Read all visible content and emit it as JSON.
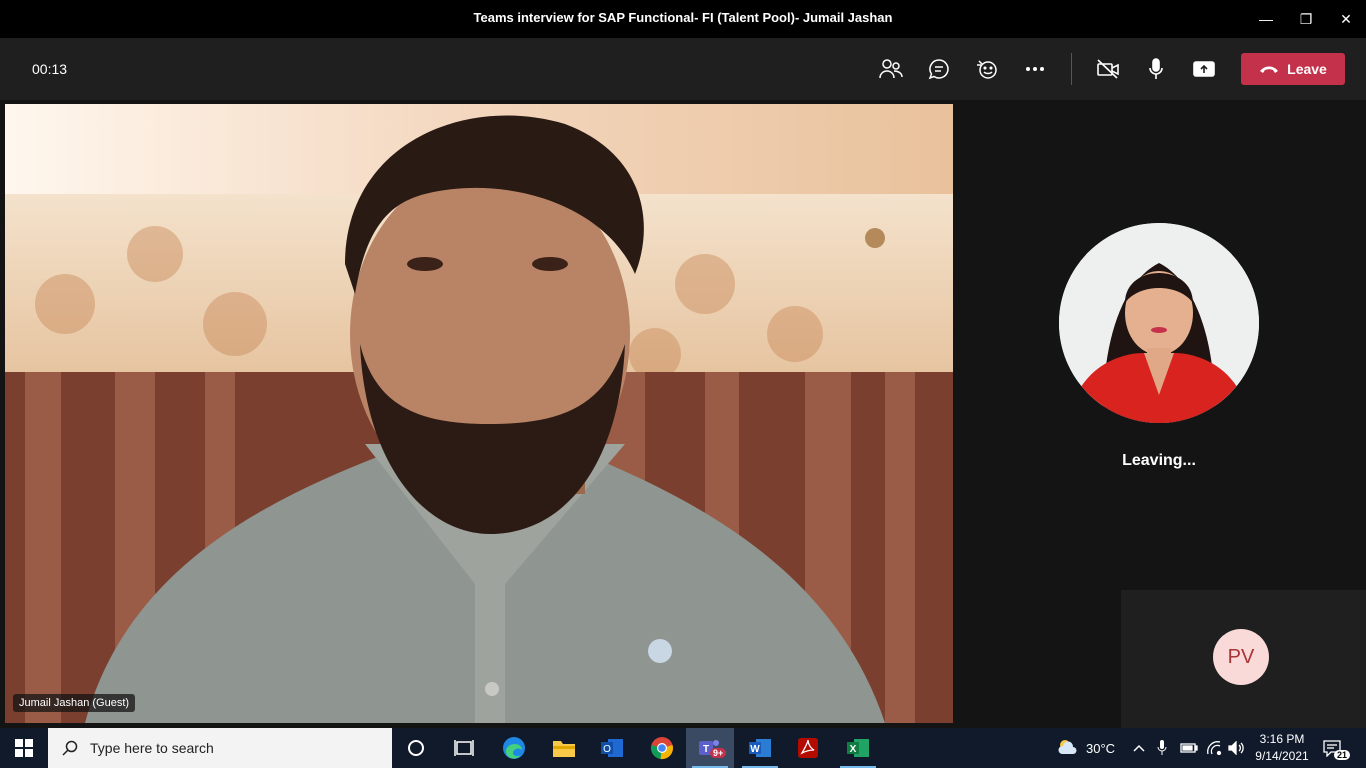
{
  "window": {
    "title": "Teams interview for SAP Functional- FI (Talent Pool)- Jumail Jashan",
    "minimize": "—",
    "restore": "❐",
    "close": "✕"
  },
  "meeting": {
    "timer": "00:13",
    "leave_label": "Leave",
    "icons": [
      "participants-icon",
      "chat-icon",
      "reactions-icon",
      "more-icon",
      "camera-off-icon",
      "microphone-icon",
      "share-icon",
      "phone-hangup-icon"
    ]
  },
  "stage": {
    "guest_label": "Jumail Jashan (Guest)",
    "leaving_text": "Leaving...",
    "initials": "PV"
  },
  "taskbar": {
    "search_placeholder": "Type here to search",
    "teams_badge": "9+",
    "temperature": "30°C",
    "time": "3:16 PM",
    "date": "9/14/2021",
    "notifications": "21"
  },
  "colors": {
    "leave": "#c4314b",
    "toolbar": "#1f1f1f",
    "taskbar": "#101a2b",
    "avatar_bg": "#fad9d9"
  }
}
